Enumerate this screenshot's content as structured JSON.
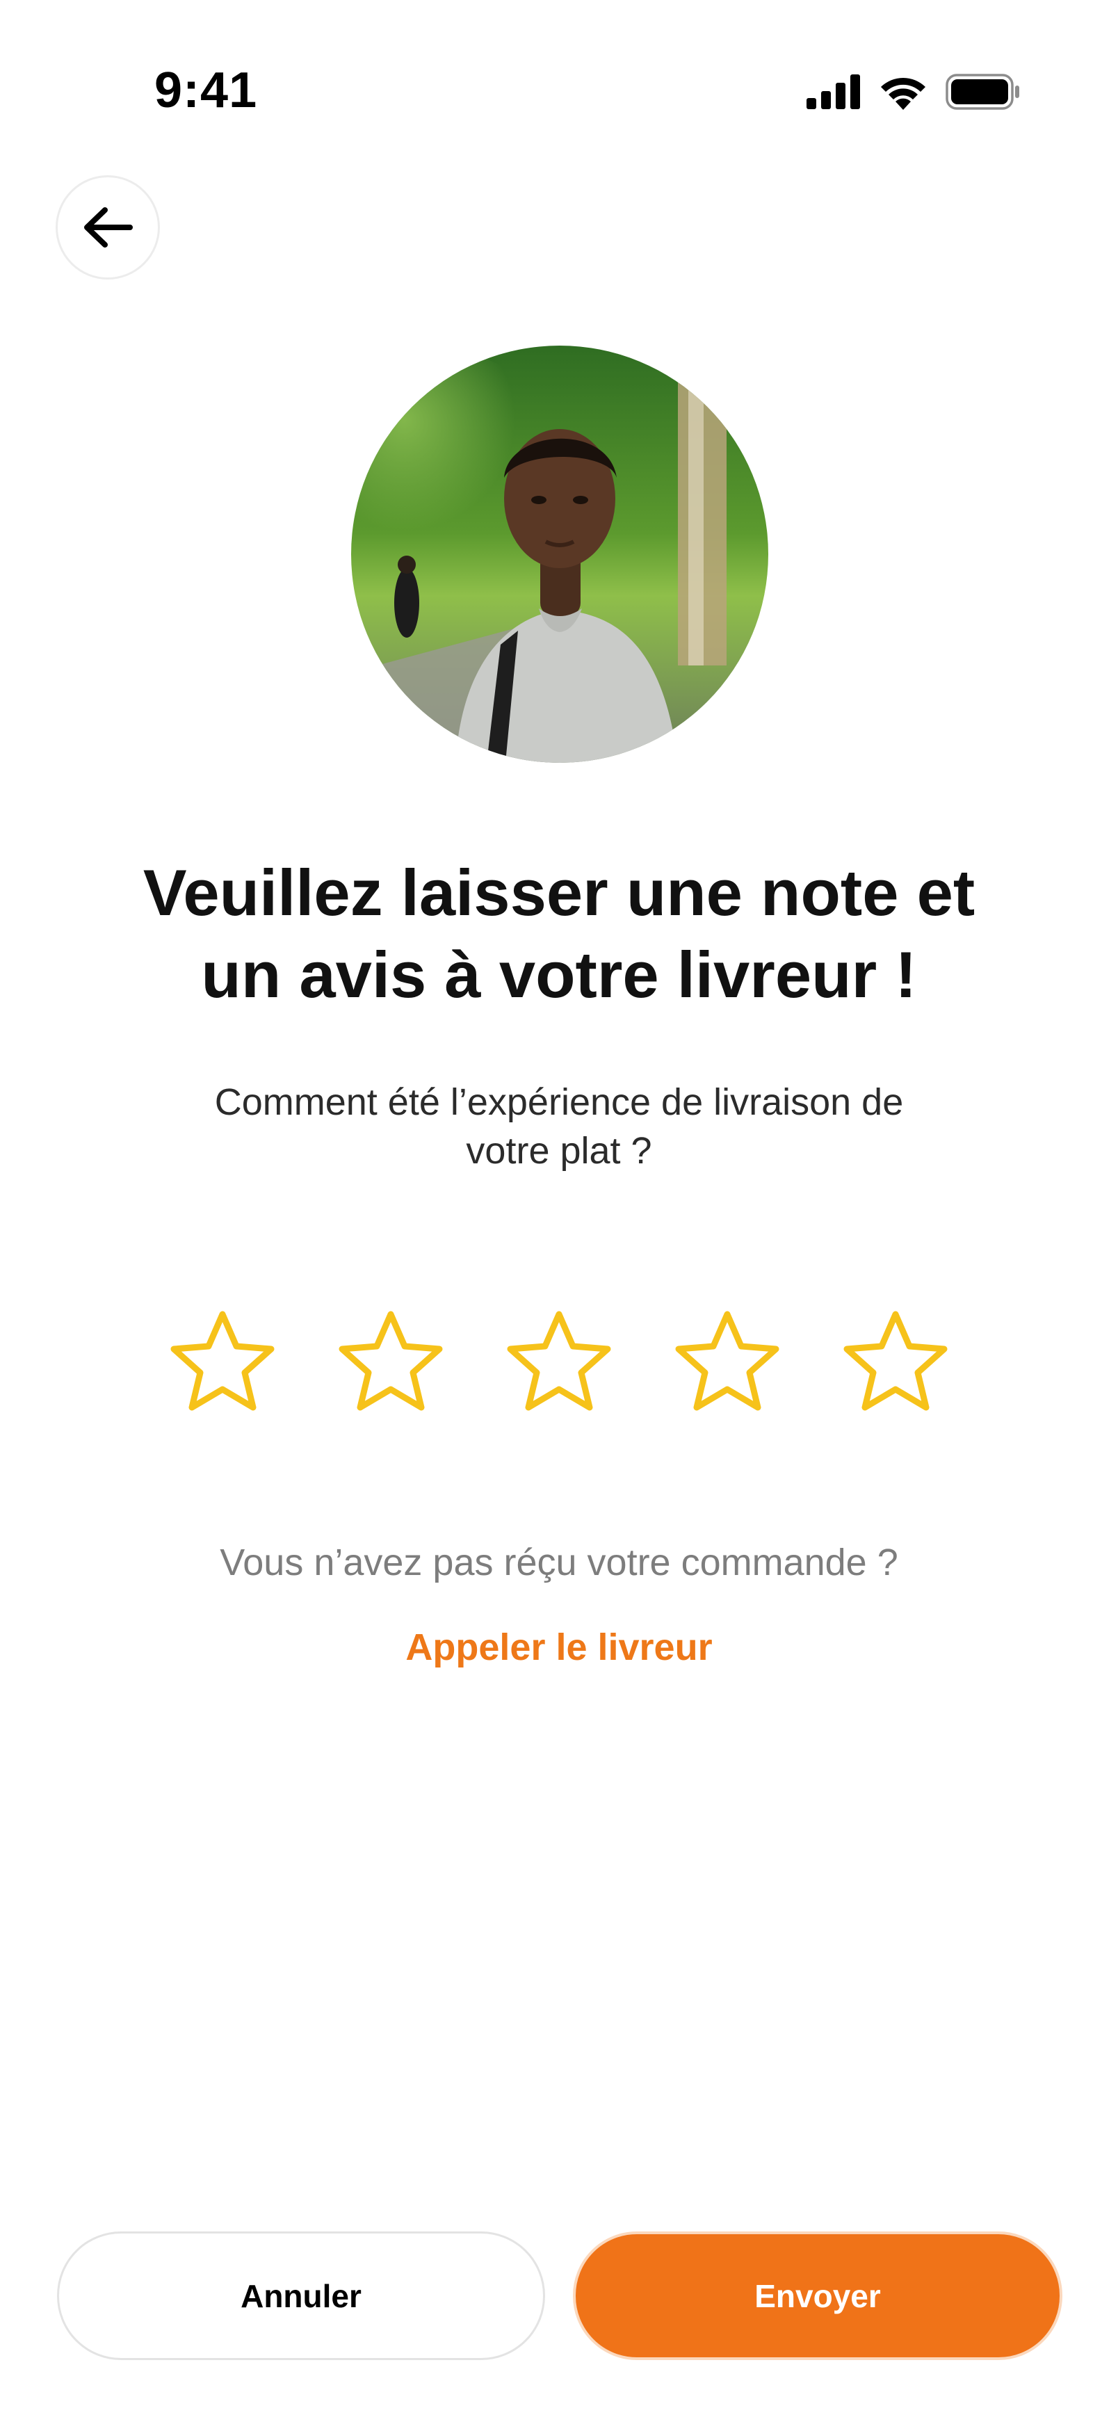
{
  "status_bar": {
    "time": "9:41",
    "icons": [
      "signal-icon",
      "wifi-icon",
      "battery-icon"
    ]
  },
  "header": {
    "back_icon": "arrow-left-icon"
  },
  "courier": {
    "avatar_description": "courier-photo"
  },
  "content": {
    "headline_line1": "Veuillez laisser une note et",
    "headline_line2": "un avis à votre livreur !",
    "subtitle_line1": "Comment été l’expérience de livraison de",
    "subtitle_line2": "votre plat  ?"
  },
  "rating": {
    "max": 5,
    "value": 0,
    "star_color": "#f6c21a"
  },
  "help": {
    "question": "Vous n’avez pas réçu votre commande ?",
    "call_link": "Appeler le livreur"
  },
  "actions": {
    "cancel_label": "Annuler",
    "send_label": "Envoyer"
  },
  "colors": {
    "accent": "#f07318",
    "link": "#ee7818",
    "star": "#f6c21a"
  }
}
